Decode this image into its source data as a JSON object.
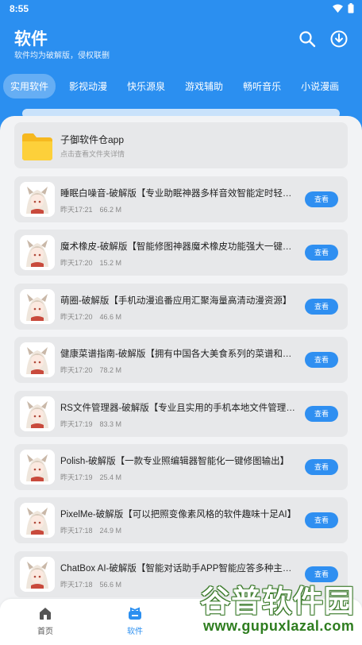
{
  "status_bar": {
    "time": "8:55"
  },
  "header": {
    "title": "软件",
    "subtitle": "软件均为破解版，侵权联删",
    "icons": [
      "search-icon",
      "download-icon"
    ]
  },
  "tabs": [
    {
      "label": "实用软件",
      "active": true
    },
    {
      "label": "影视动漫"
    },
    {
      "label": "快乐源泉"
    },
    {
      "label": "游戏辅助"
    },
    {
      "label": "畅听音乐"
    },
    {
      "label": "小说漫画"
    }
  ],
  "folder": {
    "title": "子御软件仓app",
    "subtitle": "点击查看文件夹详情"
  },
  "items": [
    {
      "name": "睡眠白噪音-破解版【专业助眠神器多样音效智能定时轻松入眠】",
      "time": "昨天17:21",
      "size": "66.2 M",
      "button": "查看"
    },
    {
      "name": "魔术橡皮-破解版【智能修图神器魔术橡皮功能强大一键消除】",
      "time": "昨天17:20",
      "size": "15.2 M",
      "button": "查看"
    },
    {
      "name": "萌圈-破解版【手机动漫追番应用汇聚海量高清动漫资源】",
      "time": "昨天17:20",
      "size": "46.6 M",
      "button": "查看"
    },
    {
      "name": "健康菜谱指南-破解版【拥有中国各大美食系列的菜谱和做法】",
      "time": "昨天17:20",
      "size": "78.2 M",
      "button": "查看"
    },
    {
      "name": "RS文件管理器-破解版【专业且实用的手机本地文件管理工具】",
      "time": "昨天17:19",
      "size": "83.3 M",
      "button": "查看"
    },
    {
      "name": "Polish-破解版【一款专业照编辑器智能化一键修图输出】",
      "time": "昨天17:19",
      "size": "25.4 M",
      "button": "查看"
    },
    {
      "name": "PixelMe-破解版【可以把照变像素风格的软件趣味十足AI】",
      "time": "昨天17:18",
      "size": "24.9 M",
      "button": "查看"
    },
    {
      "name": "ChatBox AI-破解版【智能对话助手APP智能应答多种主题】",
      "time": "昨天17:18",
      "size": "56.6 M",
      "button": "查看"
    }
  ],
  "bottom_nav": [
    {
      "label": "首页",
      "icon": "home-icon"
    },
    {
      "label": "软件",
      "icon": "software-icon",
      "active": true
    }
  ],
  "watermark": {
    "text": "谷普软件园",
    "url": "www.gupuxlazal.com"
  },
  "colors": {
    "primary": "#2b8ff0",
    "button": "#2f8ff1",
    "card": "#e7e8ea",
    "background": "#f2f3f5"
  }
}
